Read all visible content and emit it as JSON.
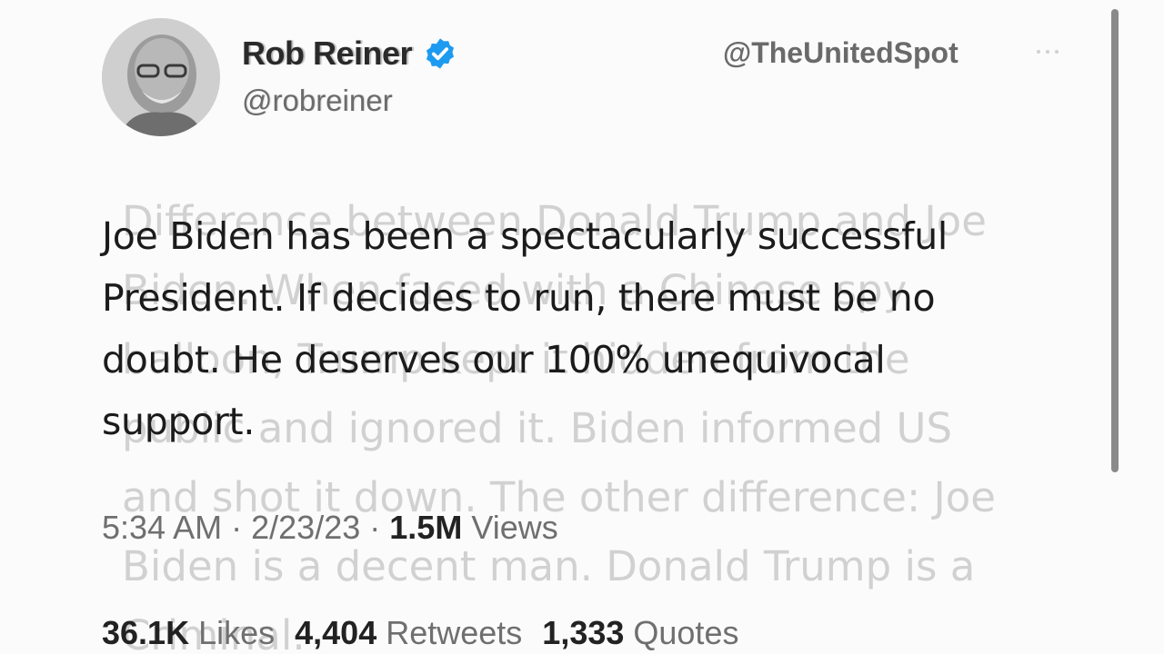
{
  "author": {
    "display_name": "Rob Reiner",
    "handle": "@robreiner",
    "verified_icon": "verified-badge-icon",
    "verified_color": "#1d9bf0"
  },
  "watermark": {
    "handle": "@TheUnitedSpot"
  },
  "tweet": {
    "text": "Joe Biden has been a spectacularly successful President. If decides to run, there must be no doubt. He deserves our 100% unequivocal support.",
    "ghost_text": "Difference between Donald Trump and Joe Biden. When faced with a Chinese spy balloon, Trump kept it hidden from the public and ignored it. Biden informed US and shot it down. The other difference: Joe Biden is a decent man. Donald Trump is a Criminal.",
    "time": "5:34 AM",
    "date": "2/23/23",
    "separator": "·",
    "views_count": "1.5M",
    "views_label": "Views"
  },
  "stats": {
    "likes_count": "36.1K",
    "likes_label": "Likes",
    "retweets_count": "4,404",
    "retweets_label": "Retweets",
    "quotes_count": "1,333",
    "quotes_label": "Quotes"
  }
}
